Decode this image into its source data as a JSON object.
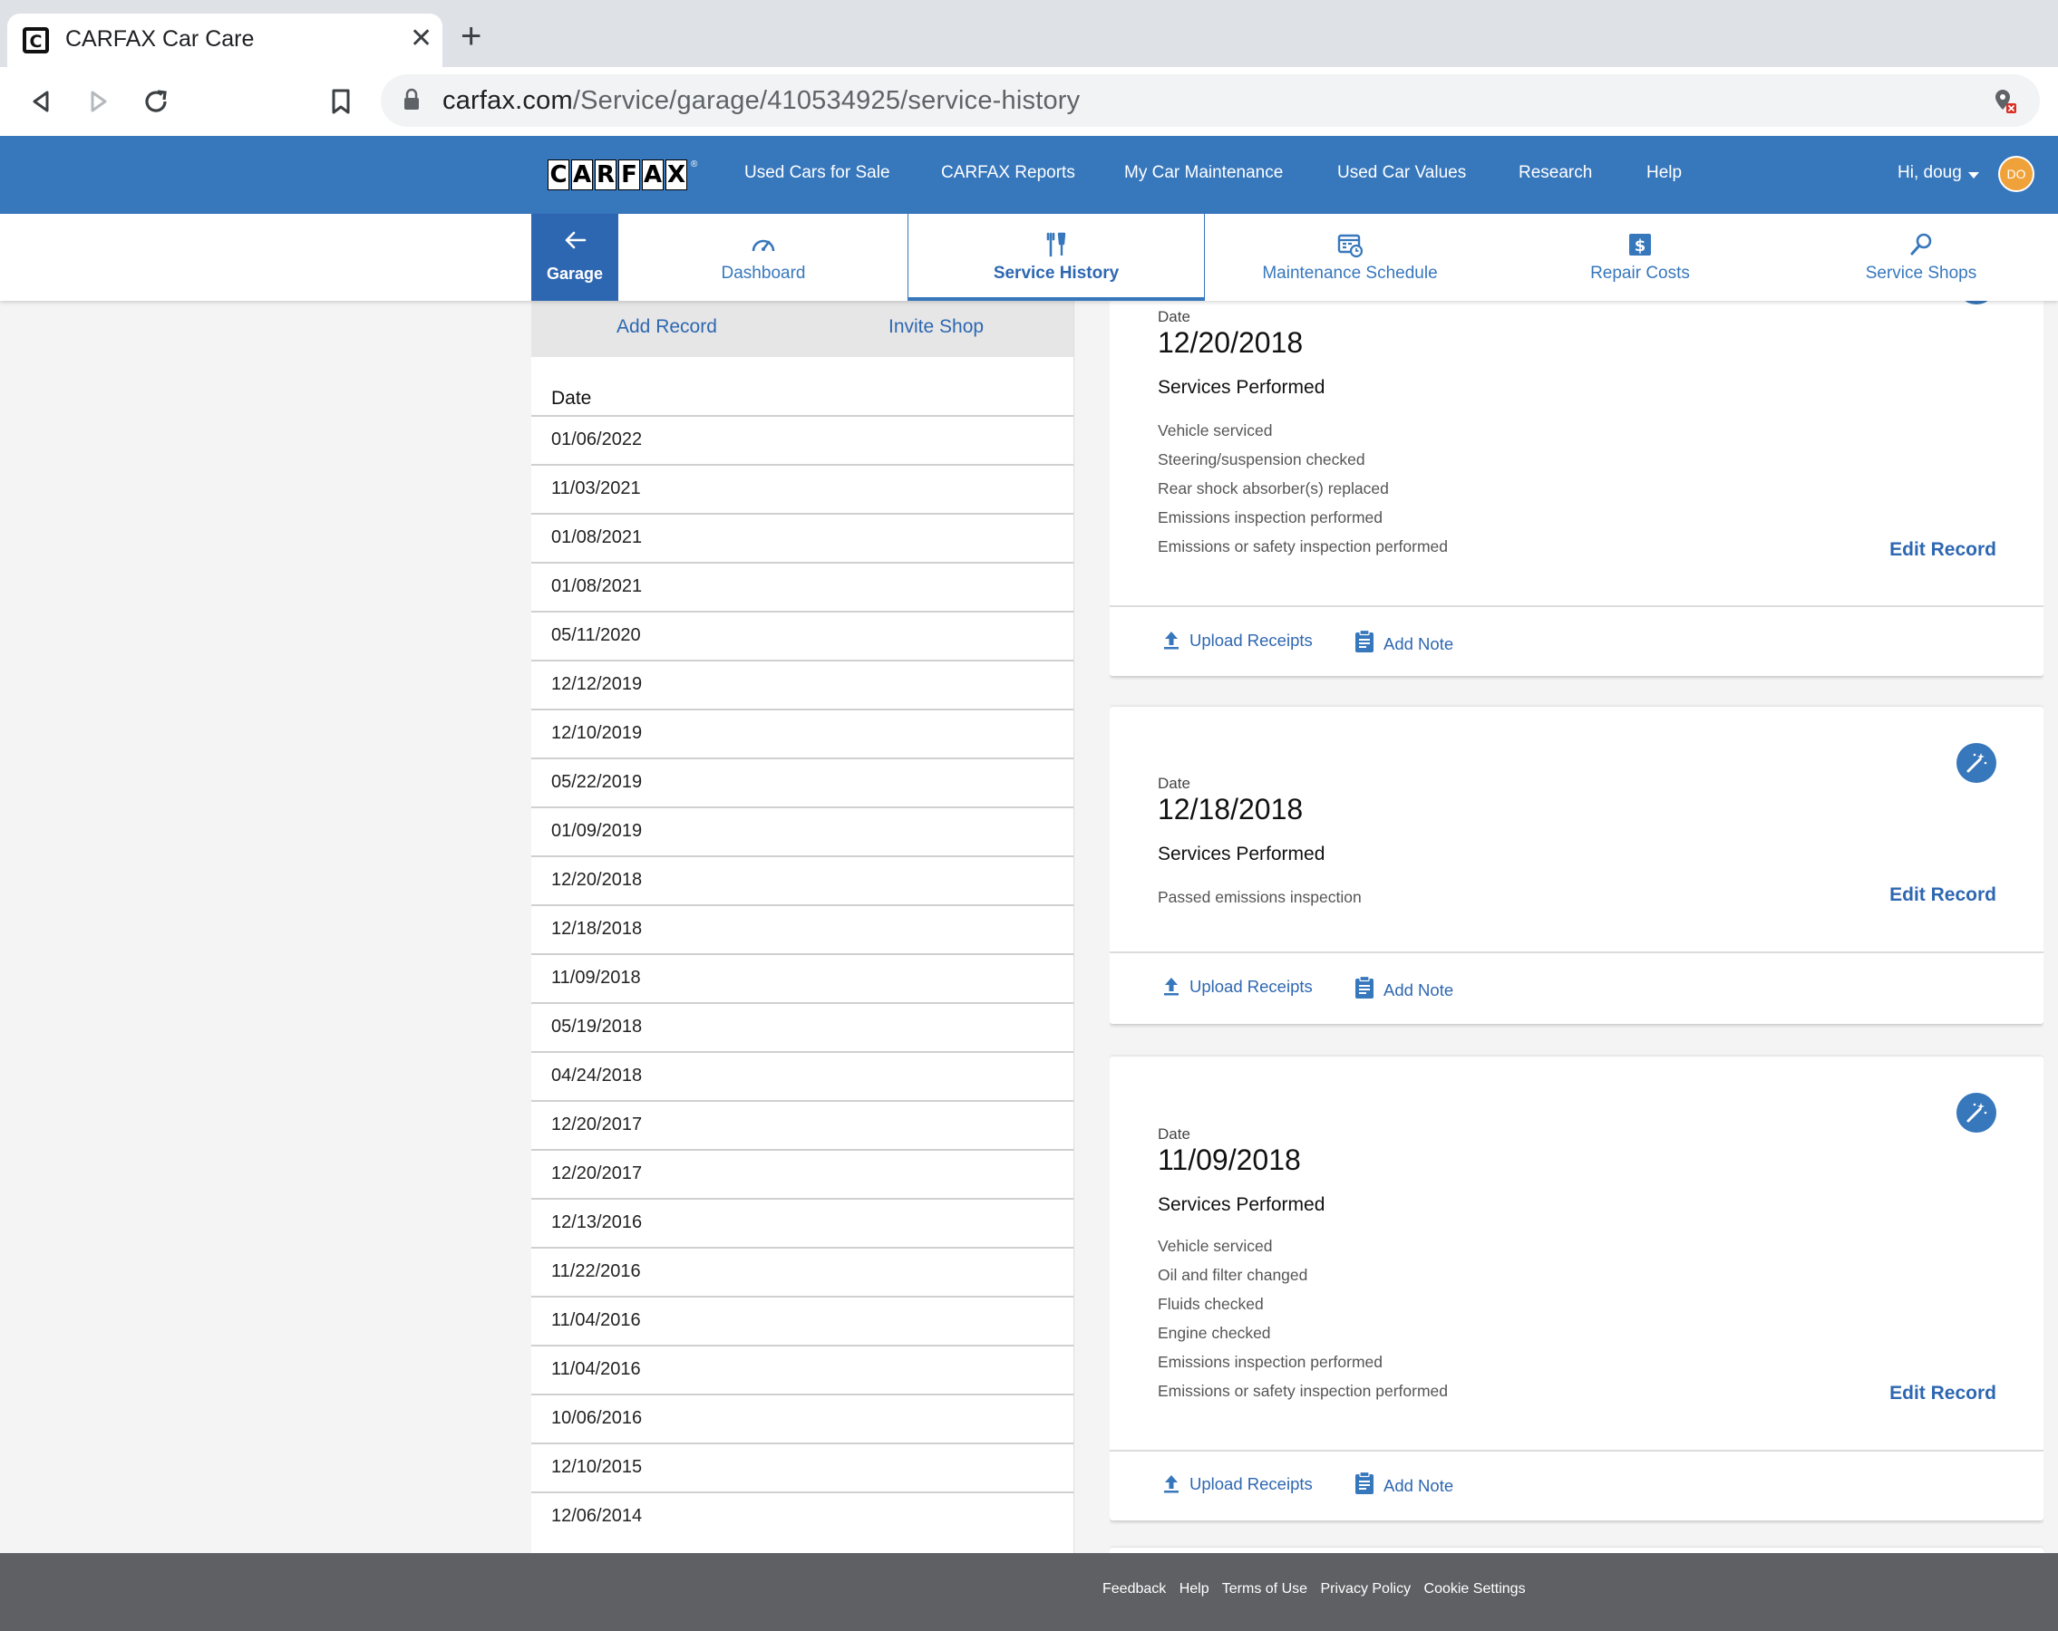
{
  "browser": {
    "tab_title": "CARFAX Car Care",
    "url_host": "carfax.com",
    "url_path": "/Service/garage/410534925/service-history"
  },
  "header": {
    "logo_letters": [
      "C",
      "A",
      "R",
      "F",
      "A",
      "X"
    ],
    "nav": [
      "Used Cars for Sale",
      "CARFAX Reports",
      "My Car Maintenance",
      "Used Car Values",
      "Research",
      "Help"
    ],
    "greeting": "Hi, doug",
    "avatar_initials": "DO"
  },
  "subnav": {
    "garage": "Garage",
    "tabs": [
      "Dashboard",
      "Service History",
      "Maintenance Schedule",
      "Repair Costs",
      "Service Shops"
    ],
    "active": "Service History"
  },
  "list": {
    "add_record": "Add Record",
    "invite_shop": "Invite Shop",
    "header": "Date",
    "dates": [
      "01/06/2022",
      "11/03/2021",
      "01/08/2021",
      "01/08/2021",
      "05/11/2020",
      "12/12/2019",
      "12/10/2019",
      "05/22/2019",
      "01/09/2019",
      "12/20/2018",
      "12/18/2018",
      "11/09/2018",
      "05/19/2018",
      "04/24/2018",
      "12/20/2017",
      "12/20/2017",
      "12/13/2016",
      "11/22/2016",
      "11/04/2016",
      "11/04/2016",
      "10/06/2016",
      "12/10/2015",
      "12/06/2014"
    ]
  },
  "cards": [
    {
      "date_label": "Date",
      "date": "12/20/2018",
      "services_label": "Services Performed",
      "services": [
        "Vehicle serviced",
        "Steering/suspension checked",
        "Rear shock absorber(s) replaced",
        "Emissions inspection performed",
        "Emissions or safety inspection performed"
      ],
      "edit": "Edit Record",
      "upload": "Upload Receipts",
      "note": "Add Note"
    },
    {
      "date_label": "Date",
      "date": "12/18/2018",
      "services_label": "Services Performed",
      "services": [
        "Passed emissions inspection"
      ],
      "edit": "Edit Record",
      "upload": "Upload Receipts",
      "note": "Add Note"
    },
    {
      "date_label": "Date",
      "date": "11/09/2018",
      "services_label": "Services Performed",
      "services": [
        "Vehicle serviced",
        "Oil and filter changed",
        "Fluids checked",
        "Engine checked",
        "Emissions inspection performed",
        "Emissions or safety inspection performed"
      ],
      "edit": "Edit Record",
      "upload": "Upload Receipts",
      "note": "Add Note"
    }
  ],
  "footer": {
    "links": [
      "Feedback",
      "Help",
      "Terms of Use",
      "Privacy Policy",
      "Cookie Settings"
    ]
  },
  "colors": {
    "brand_blue": "#3777bc",
    "garage_blue": "#2e67b1",
    "footer_gray": "#5e6064",
    "avatar_orange": "#f0a23a"
  }
}
